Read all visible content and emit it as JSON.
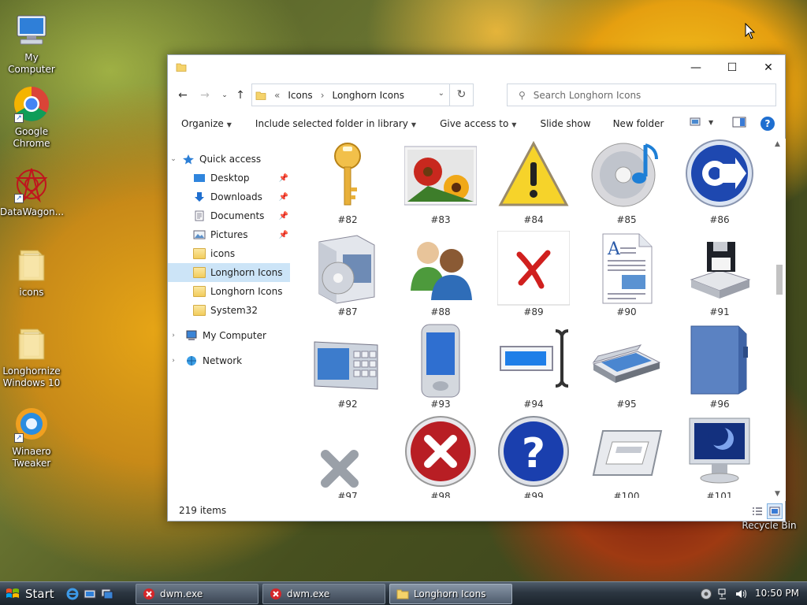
{
  "desktop": {
    "icons": [
      {
        "label": "My Computer",
        "icon": "computer-icon"
      },
      {
        "label": "Google Chrome",
        "icon": "chrome-icon"
      },
      {
        "label": "DataWagon...",
        "icon": "datawagon-icon"
      },
      {
        "label": "icons",
        "icon": "folder-icon"
      },
      {
        "label": "Longhornize Windows 10",
        "icon": "folder-icon"
      },
      {
        "label": "Winaero Tweaker",
        "icon": "winaero-icon"
      },
      {
        "label": "Recycle Bin",
        "icon": "recycle-bin-icon"
      }
    ]
  },
  "window": {
    "title": "",
    "controls": {
      "minimize": "—",
      "maximize": "☐",
      "close": "✕"
    },
    "breadcrumb": {
      "overflow": "«",
      "parts": [
        "Icons",
        "Longhorn Icons"
      ],
      "sep": "›"
    },
    "search_placeholder": "Search Longhorn Icons",
    "commands": {
      "organize": "Organize",
      "include": "Include selected folder in library",
      "share": "Give access to",
      "slideshow": "Slide show",
      "new_folder": "New folder",
      "help": "?"
    },
    "nav": {
      "quick_access": "Quick access",
      "items": [
        {
          "label": "Desktop",
          "icon": "desktop-icon",
          "pinned": true
        },
        {
          "label": "Downloads",
          "icon": "downloads-icon",
          "pinned": true
        },
        {
          "label": "Documents",
          "icon": "documents-icon",
          "pinned": true
        },
        {
          "label": "Pictures",
          "icon": "pictures-icon",
          "pinned": true
        },
        {
          "label": "icons",
          "icon": "folder-icon",
          "pinned": false
        },
        {
          "label": "Longhorn Icons",
          "icon": "folder-icon",
          "pinned": false,
          "selected": true
        },
        {
          "label": "Longhorn Icons",
          "icon": "folder-icon",
          "pinned": false
        },
        {
          "label": "System32",
          "icon": "folder-icon",
          "pinned": false
        }
      ],
      "my_computer": "My Computer",
      "network": "Network"
    },
    "files": [
      {
        "label": "#82",
        "icon": "key-icon"
      },
      {
        "label": "#83",
        "icon": "flowers-photo-icon"
      },
      {
        "label": "#84",
        "icon": "warning-icon"
      },
      {
        "label": "#85",
        "icon": "cd-music-icon"
      },
      {
        "label": "#86",
        "icon": "blue-arrow-disc-icon"
      },
      {
        "label": "#87",
        "icon": "software-box-icon"
      },
      {
        "label": "#88",
        "icon": "users-icon"
      },
      {
        "label": "#89",
        "icon": "red-x-card-icon"
      },
      {
        "label": "#90",
        "icon": "document-icon"
      },
      {
        "label": "#91",
        "icon": "floppy-drive-icon"
      },
      {
        "label": "#92",
        "icon": "keypad-device-icon"
      },
      {
        "label": "#93",
        "icon": "pda-icon"
      },
      {
        "label": "#94",
        "icon": "text-cursor-field-icon"
      },
      {
        "label": "#95",
        "icon": "scanner-icon"
      },
      {
        "label": "#96",
        "icon": "blue-folder-icon"
      },
      {
        "label": "#97",
        "icon": "gray-x-icon"
      },
      {
        "label": "#98",
        "icon": "red-circle-x-icon"
      },
      {
        "label": "#99",
        "icon": "help-circle-icon"
      },
      {
        "label": "#100",
        "icon": "frame-icon"
      },
      {
        "label": "#101",
        "icon": "monitor-icon"
      }
    ],
    "status": {
      "count": "219 items"
    }
  },
  "taskbar": {
    "start": "Start",
    "tasks": [
      {
        "label": "dwm.exe",
        "icon": "error-icon"
      },
      {
        "label": "dwm.exe",
        "icon": "error-icon"
      },
      {
        "label": "Longhorn Icons",
        "icon": "folder-icon",
        "active": true
      }
    ],
    "clock": "10:50 PM"
  }
}
